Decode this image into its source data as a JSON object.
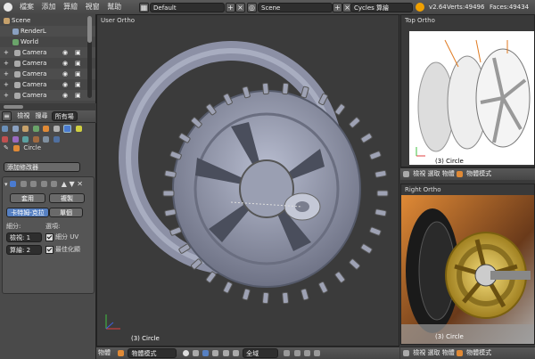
{
  "menu": {
    "file": "檔案",
    "add": "添加",
    "render": "算繪",
    "window": "視窗",
    "help": "幫助"
  },
  "header": {
    "screen_layout": "Default",
    "scene": "Scene",
    "engine": "Cycles 算繪"
  },
  "stats": {
    "version": "v2.64",
    "verts": "Verts:49496",
    "faces": "Faces:49434"
  },
  "outliner": {
    "items": [
      {
        "label": "Scene",
        "icon": "scene-icon"
      },
      {
        "label": "RenderL",
        "icon": "render-layers-icon"
      },
      {
        "label": "World",
        "icon": "world-icon"
      },
      {
        "label": "Camera",
        "icon": "camera-icon"
      },
      {
        "label": "Camera",
        "icon": "camera-icon"
      },
      {
        "label": "Camera",
        "icon": "camera-icon"
      },
      {
        "label": "Camera",
        "icon": "camera-icon"
      },
      {
        "label": "Camera",
        "icon": "camera-icon"
      }
    ],
    "footer": {
      "view": "檢視",
      "search": "搜尋",
      "all": "所有場"
    }
  },
  "properties": {
    "object_name": "Circle",
    "add_modifier": "添加修改器",
    "apply": "套用",
    "copy": "複製",
    "catmull": "卡特姆-克拉",
    "simple": "單個",
    "subdiv_label": "細分:",
    "options_label": "選項:",
    "view_field": "檢視: 1",
    "render_field": "算繪: 2",
    "subdivide_uv": "細分 UV",
    "optimal": "最佳化顯"
  },
  "viewports": {
    "main": {
      "title": "User Ortho",
      "object": "(3) Circle"
    },
    "top": {
      "title": "Top Ortho",
      "object": "(3) Circle"
    },
    "right": {
      "title": "Right Ortho",
      "object": "(3) Circle"
    }
  },
  "bottombars": {
    "main": {
      "view": "物體",
      "mode": "物體模式",
      "global": "全域"
    },
    "top": {
      "view": "檢視",
      "select": "選取",
      "object": "物體",
      "mode": "物體模式"
    },
    "right": {
      "view": "檢視",
      "select": "選取",
      "object": "物體",
      "mode": "物體模式"
    }
  },
  "colors": {
    "accent": "#5680c2",
    "header": "#4a4a4a",
    "viewport": "#393939",
    "gold": "#d9b84a",
    "orange": "#e07a20"
  }
}
